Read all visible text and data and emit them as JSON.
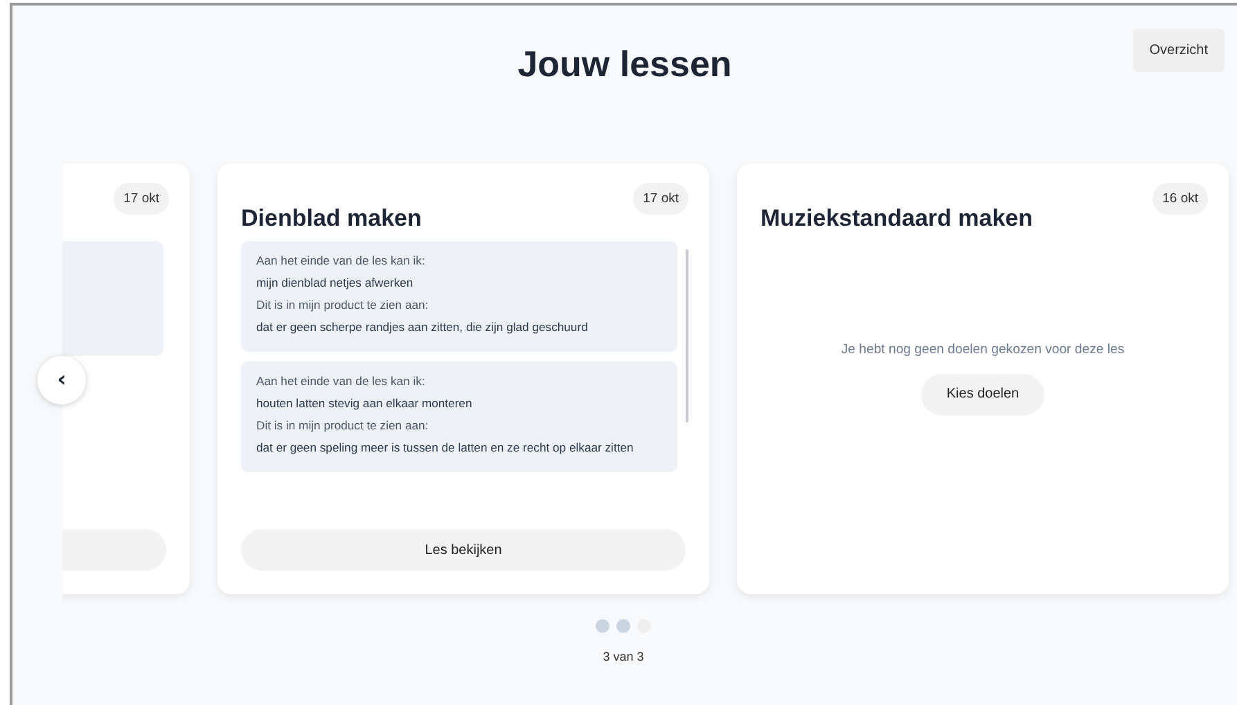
{
  "title": "Jouw lessen",
  "overview_button": "Overzicht",
  "prev_button": "‹",
  "lessons": [
    {
      "kind": "clipped",
      "date": "17 okt"
    },
    {
      "kind": "goals",
      "title": "Dienblad maken",
      "date": "17 okt",
      "goals": [
        {
          "label": "Aan het einde van de les kan ik:",
          "goal": "mijn dienblad netjes afwerken",
          "evidence_label": "Dit is in mijn product te zien aan:",
          "evidence": "dat er geen scherpe randjes aan zitten, die zijn glad geschuurd"
        },
        {
          "label": "Aan het einde van de les kan ik:",
          "goal": "houten latten stevig aan elkaar monteren",
          "evidence_label": "Dit is in mijn product te zien aan:",
          "evidence": "dat er geen speling meer is tussen de latten en ze recht op elkaar zitten"
        }
      ],
      "button": "Les bekijken"
    },
    {
      "kind": "empty",
      "title": "Muziekstandaard maken",
      "date": "16 okt",
      "message": "Je hebt nog geen doelen gekozen voor deze les",
      "button": "Kies doelen"
    }
  ],
  "pager": {
    "dots": [
      {
        "selected": false
      },
      {
        "selected": false
      },
      {
        "selected": true
      }
    ],
    "label": "3 van 3"
  }
}
